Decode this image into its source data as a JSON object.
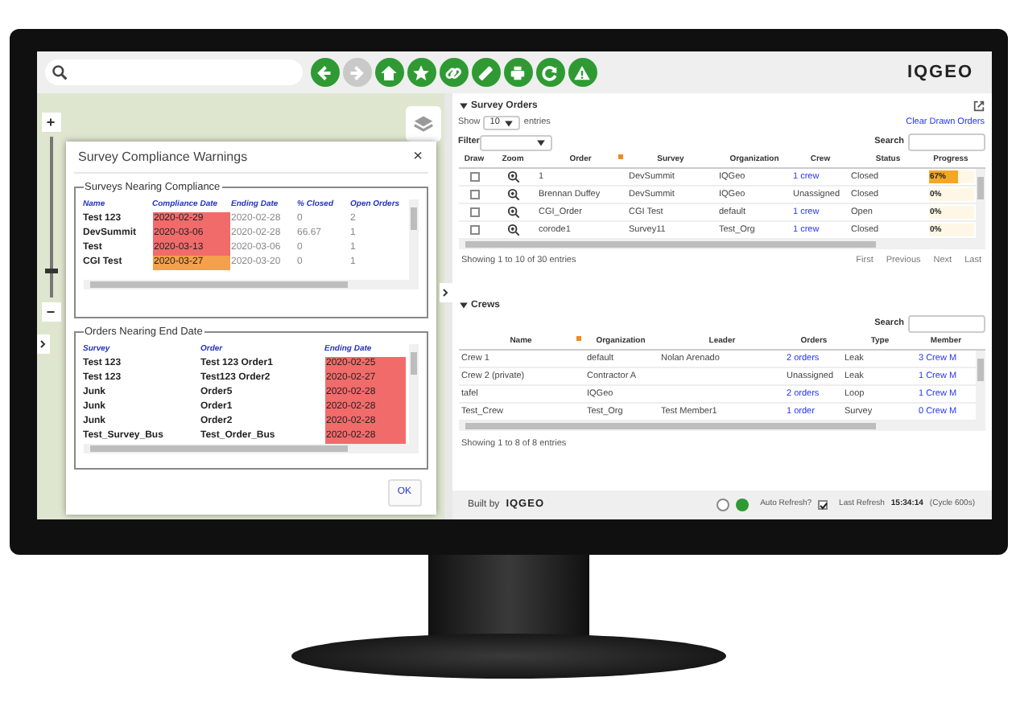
{
  "toolbar": {
    "buttons": [
      {
        "kind": "back",
        "disabled": false
      },
      {
        "kind": "forward",
        "disabled": true
      },
      {
        "kind": "home",
        "disabled": false
      },
      {
        "kind": "star",
        "disabled": false
      },
      {
        "kind": "link",
        "disabled": false
      },
      {
        "kind": "ruler",
        "disabled": false
      },
      {
        "kind": "print",
        "disabled": false
      },
      {
        "kind": "refresh",
        "disabled": false
      },
      {
        "kind": "warning",
        "disabled": false
      }
    ],
    "logo": "IQGEO"
  },
  "map": {
    "zoom_in": "+",
    "zoom_out": "−",
    "zoom": {
      "level": 0.15
    }
  },
  "dialog": {
    "title": "Survey Compliance Warnings",
    "close": "×",
    "surveys": {
      "legend": "Surveys Nearing Compliance",
      "columns": [
        "Name",
        "Compliance Date",
        "Ending Date",
        "% Closed",
        "Open Orders"
      ],
      "rows": [
        {
          "name": "Test 123",
          "compliance_date": "2020-02-29",
          "color": "#f26b6b",
          "ending_date": "2020-02-28",
          "closed": "0",
          "open_orders": "2"
        },
        {
          "name": "DevSummit",
          "compliance_date": "2020-03-06",
          "color": "#f26b6b",
          "ending_date": "2020-02-28",
          "closed": "66.67",
          "open_orders": "1"
        },
        {
          "name": "Test",
          "compliance_date": "2020-03-13",
          "color": "#f26b6b",
          "ending_date": "2020-03-06",
          "closed": "0",
          "open_orders": "1"
        },
        {
          "name": "CGI Test",
          "compliance_date": "2020-03-27",
          "color": "#f5a04a",
          "ending_date": "2020-03-20",
          "closed": "0",
          "open_orders": "1"
        }
      ]
    },
    "orders": {
      "legend": "Orders Nearing End Date",
      "columns": [
        "Survey",
        "Order",
        "Ending Date"
      ],
      "rows": [
        {
          "survey": "Test 123",
          "order": "Test 123 Order1",
          "ending_date": "2020-02-25",
          "color": "#f26b6b"
        },
        {
          "survey": "Test 123",
          "order": "Test123 Order2",
          "ending_date": "2020-02-27",
          "color": "#f26b6b"
        },
        {
          "survey": "Junk",
          "order": "Order5",
          "ending_date": "2020-02-28",
          "color": "#f26b6b"
        },
        {
          "survey": "Junk",
          "order": "Order1",
          "ending_date": "2020-02-28",
          "color": "#f26b6b"
        },
        {
          "survey": "Junk",
          "order": "Order2",
          "ending_date": "2020-02-28",
          "color": "#f26b6b"
        },
        {
          "survey": "Test_Survey_Bus",
          "order": "Test_Order_Bus",
          "ending_date": "2020-02-28",
          "color": "#f26b6b"
        }
      ]
    },
    "ok": "OK"
  },
  "survey_orders": {
    "title": "Survey Orders",
    "expanded": true,
    "show_label": "Show",
    "page_size": "10",
    "entries_label": "entries",
    "clear_link": "Clear Drawn Orders",
    "filter_label": "Filter",
    "search_label": "Search",
    "columns": [
      {
        "label": "Draw",
        "sorted": false
      },
      {
        "label": "Zoom",
        "sorted": false
      },
      {
        "label": "Order",
        "sorted": true
      },
      {
        "label": "Survey",
        "sorted": false
      },
      {
        "label": "Organization",
        "sorted": false
      },
      {
        "label": "Crew",
        "sorted": false
      },
      {
        "label": "Status",
        "sorted": false
      },
      {
        "label": "Progress",
        "sorted": false
      }
    ],
    "rows": [
      {
        "draw": false,
        "order": "1",
        "survey": "DevSummit",
        "organization": "IQGeo",
        "crew": {
          "text": "1 crew",
          "link": true
        },
        "status": "Closed",
        "progress": {
          "text": "67%",
          "level": 0.67
        }
      },
      {
        "draw": false,
        "order": "Brennan Duffey",
        "survey": "DevSummit",
        "organization": "IQGeo",
        "crew": {
          "text": "Unassigned",
          "link": false
        },
        "status": "Closed",
        "progress": {
          "text": "0%",
          "level": 0
        }
      },
      {
        "draw": false,
        "order": "CGI_Order",
        "survey": "CGI Test",
        "organization": "default",
        "crew": {
          "text": "1 crew",
          "link": true
        },
        "status": "Open",
        "progress": {
          "text": "0%",
          "level": 0
        }
      },
      {
        "draw": false,
        "order": "corode1",
        "survey": "Survey11",
        "organization": "Test_Org",
        "crew": {
          "text": "1 crew",
          "link": true
        },
        "status": "Closed",
        "progress": {
          "text": "0%",
          "level": 0
        }
      }
    ],
    "info": "Showing 1 to 10 of 30 entries",
    "pager": [
      "First",
      "Previous",
      "Next",
      "Last"
    ]
  },
  "crews": {
    "title": "Crews",
    "expanded": true,
    "search_label": "Search",
    "columns": [
      {
        "label": "Name",
        "sorted": true
      },
      {
        "label": "Organization",
        "sorted": false
      },
      {
        "label": "Leader",
        "sorted": false
      },
      {
        "label": "Orders",
        "sorted": false
      },
      {
        "label": "Type",
        "sorted": false
      },
      {
        "label": "Member",
        "sorted": false
      }
    ],
    "rows": [
      {
        "name": "Crew 1",
        "organization": "default",
        "leader": "Nolan Arenado",
        "orders": {
          "text": "2 orders",
          "link": true
        },
        "type": "Leak",
        "members": "3 Crew M"
      },
      {
        "name": "Crew 2 (private)",
        "organization": "Contractor A",
        "orders": {
          "text": "Unassigned",
          "link": false
        },
        "type": "Leak",
        "members": "1 Crew M"
      },
      {
        "name": "tafel",
        "organization": "IQGeo",
        "orders": {
          "text": "2 orders",
          "link": true
        },
        "type": "Loop",
        "members": "1 Crew M"
      },
      {
        "name": "Test_Crew",
        "organization": "Test_Org",
        "leader": "Test Member1",
        "orders": {
          "text": "1 order",
          "link": true
        },
        "type": "Survey",
        "members": "0 Crew M"
      }
    ],
    "info": "Showing 1 to 8 of 8 entries"
  },
  "status_bar": {
    "built_by": "Built by",
    "logo": "IQGEO",
    "indicators": [
      {
        "on": false
      },
      {
        "on": true
      }
    ],
    "auto_refresh_label": "Auto Refresh?",
    "auto_refresh": true,
    "last_refresh_label": "Last Refresh",
    "last_refresh": "15:34:14",
    "cycle": "(Cycle 600s)"
  }
}
